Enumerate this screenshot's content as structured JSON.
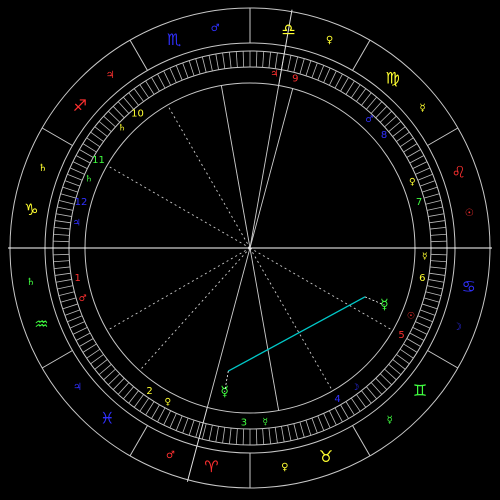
{
  "colors": {
    "background": "#000000",
    "ring": "#c8c8c8",
    "fire": "#ff3030",
    "earth": "#ffff30",
    "air": "#40ff40",
    "water": "#3030ff",
    "aspect_sextile": "#00c8c8",
    "axis": "#ffffff"
  },
  "zodiac_signs": [
    {
      "name": "libra",
      "glyph": "♎",
      "color": "#ffff30"
    },
    {
      "name": "virgo",
      "glyph": "♍",
      "color": "#ffff30"
    },
    {
      "name": "leo",
      "glyph": "♌",
      "color": "#ff3030"
    },
    {
      "name": "cancer",
      "glyph": "♋",
      "color": "#3030ff"
    },
    {
      "name": "gemini",
      "glyph": "♊",
      "color": "#40ff40"
    },
    {
      "name": "taurus",
      "glyph": "♉",
      "color": "#ffff30"
    },
    {
      "name": "aries",
      "glyph": "♈",
      "color": "#ff3030"
    },
    {
      "name": "pisces",
      "glyph": "♓",
      "color": "#3030ff"
    },
    {
      "name": "aquarius",
      "glyph": "♒",
      "color": "#40ff40"
    },
    {
      "name": "capricorn",
      "glyph": "♑",
      "color": "#ffff30"
    },
    {
      "name": "sagittarius",
      "glyph": "♐",
      "color": "#ff3030"
    },
    {
      "name": "scorpio",
      "glyph": "♏",
      "color": "#3030ff"
    }
  ],
  "sign_rulers": [
    {
      "sign": "libra",
      "glyph": "♀",
      "color": "#ffff30"
    },
    {
      "sign": "virgo",
      "glyph": "☿",
      "color": "#ffff30"
    },
    {
      "sign": "leo",
      "glyph": "☉",
      "color": "#ff3030"
    },
    {
      "sign": "cancer",
      "glyph": "☽",
      "color": "#3030ff"
    },
    {
      "sign": "gemini",
      "glyph": "☿",
      "color": "#40ff40"
    },
    {
      "sign": "taurus",
      "glyph": "♀",
      "color": "#ffff30"
    },
    {
      "sign": "aries",
      "glyph": "♂",
      "color": "#ff3030"
    },
    {
      "sign": "pisces",
      "glyph": "♃",
      "color": "#3030ff"
    },
    {
      "sign": "aquarius",
      "glyph": "♄",
      "color": "#40ff40"
    },
    {
      "sign": "capricorn",
      "glyph": "♄",
      "color": "#ffff30"
    },
    {
      "sign": "sagittarius",
      "glyph": "♃",
      "color": "#ff3030"
    },
    {
      "sign": "scorpio",
      "glyph": "♂",
      "color": "#3030ff"
    }
  ],
  "houses": [
    {
      "number": "1",
      "color": "#ff3030",
      "ruler_glyph": "♂",
      "ruler_color": "#ff3030"
    },
    {
      "number": "2",
      "color": "#ffff30",
      "ruler_glyph": "♀",
      "ruler_color": "#ffff30"
    },
    {
      "number": "3",
      "color": "#40ff40",
      "ruler_glyph": "☿",
      "ruler_color": "#40ff40"
    },
    {
      "number": "4",
      "color": "#3030ff",
      "ruler_glyph": "☽",
      "ruler_color": "#3030ff"
    },
    {
      "number": "5",
      "color": "#ff3030",
      "ruler_glyph": "☉",
      "ruler_color": "#ff3030"
    },
    {
      "number": "6",
      "color": "#ffff30",
      "ruler_glyph": "☿",
      "ruler_color": "#ffff30"
    },
    {
      "number": "7",
      "color": "#40ff40",
      "ruler_glyph": "♀",
      "ruler_color": "#ffff30"
    },
    {
      "number": "8",
      "color": "#3030ff",
      "ruler_glyph": "♂",
      "ruler_color": "#3030ff"
    },
    {
      "number": "9",
      "color": "#ff3030",
      "ruler_glyph": "♃",
      "ruler_color": "#ff3030"
    },
    {
      "number": "10",
      "color": "#ffff30",
      "ruler_glyph": "♄",
      "ruler_color": "#ffff30"
    },
    {
      "number": "11",
      "color": "#40ff40",
      "ruler_glyph": "♄",
      "ruler_color": "#40ff40"
    },
    {
      "number": "12",
      "color": "#3030ff",
      "ruler_glyph": "♃",
      "ruler_color": "#3030ff"
    }
  ],
  "planets": [
    {
      "name": "mercury",
      "glyph": "☿",
      "color": "#40ff40",
      "label": "upper"
    },
    {
      "name": "mercury",
      "glyph": "☿",
      "color": "#40ff40",
      "label": "lower"
    }
  ]
}
